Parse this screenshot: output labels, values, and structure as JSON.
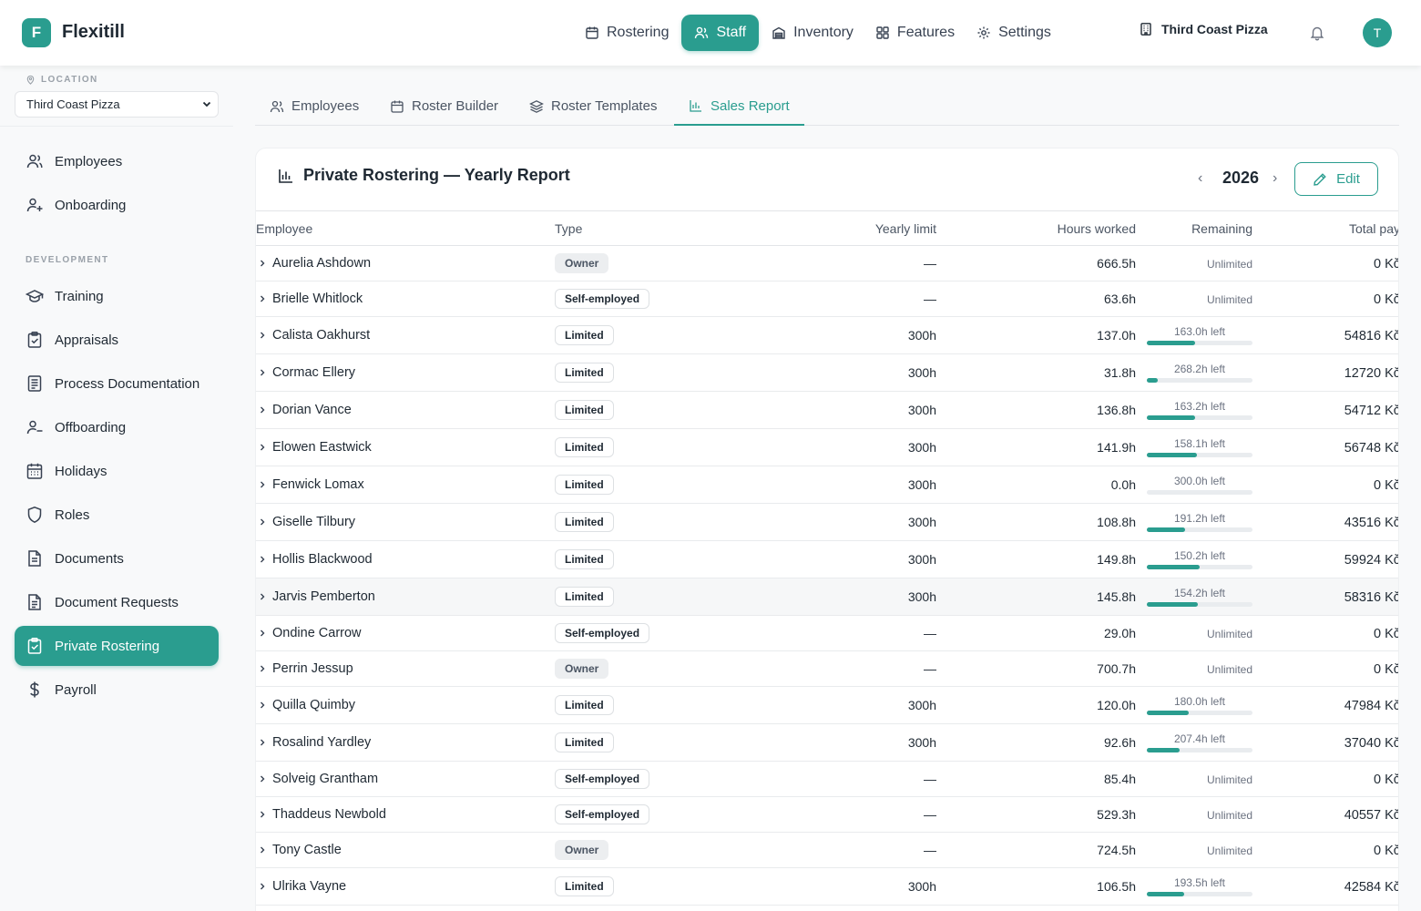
{
  "app": {
    "brand": "Flexitill",
    "logo_letter": "F",
    "avatar_letter": "T"
  },
  "nav": {
    "items": [
      {
        "label": "Rostering",
        "icon": "calendar-icon"
      },
      {
        "label": "Staff",
        "icon": "staff-icon",
        "active": true
      },
      {
        "label": "Inventory",
        "icon": "inventory-icon"
      },
      {
        "label": "Features",
        "icon": "grid-icon"
      },
      {
        "label": "Settings",
        "icon": "gear-icon"
      }
    ],
    "location": "Third Coast Pizza"
  },
  "sidebar": {
    "location_label": "LOCATION",
    "location_value": "Third Coast Pizza",
    "top_items": [
      {
        "label": "Employees",
        "icon": "users-icon"
      },
      {
        "label": "Onboarding",
        "icon": "user-plus-icon"
      }
    ],
    "section_label": "DEVELOPMENT",
    "dev_items": [
      {
        "label": "Training",
        "icon": "graduation-cap-icon"
      },
      {
        "label": "Appraisals",
        "icon": "clipboard-check-icon"
      },
      {
        "label": "Process Documentation",
        "icon": "book-icon"
      },
      {
        "label": "Offboarding",
        "icon": "user-minus-icon"
      },
      {
        "label": "Holidays",
        "icon": "calendar-icon"
      },
      {
        "label": "Roles",
        "icon": "shield-icon"
      },
      {
        "label": "Documents",
        "icon": "file-icon"
      },
      {
        "label": "Document Requests",
        "icon": "file-text-icon"
      },
      {
        "label": "Private Rostering",
        "icon": "clipboard-check-icon",
        "active": true
      },
      {
        "label": "Payroll",
        "icon": "dollar-icon"
      }
    ]
  },
  "tabs": [
    {
      "label": "Employees"
    },
    {
      "label": "Roster Builder"
    },
    {
      "label": "Roster Templates"
    },
    {
      "label": "Sales Report",
      "active": true
    }
  ],
  "report": {
    "title": "Private Rostering — Yearly Report",
    "year": "2026",
    "prev": "‹",
    "next": "›",
    "edit_label": "Edit",
    "columns": [
      "Employee",
      "Type",
      "Yearly limit",
      "Hours worked",
      "Remaining",
      "Total pay"
    ],
    "rows": [
      {
        "name": "Aurelia Ashdown",
        "type": "Owner",
        "limit": "—",
        "hours": "666.5h",
        "remaining": "Unlimited",
        "pay": "0 Kč"
      },
      {
        "name": "Brielle Whitlock",
        "type": "Self-employed",
        "limit": "—",
        "hours": "63.6h",
        "remaining": "Unlimited",
        "pay": "0 Kč"
      },
      {
        "name": "Calista Oakhurst",
        "type": "Limited",
        "limit": "300h",
        "hours": "137.0h",
        "remaining": "163.0h left",
        "used_fraction": 0.457,
        "pay": "54816 Kč"
      },
      {
        "name": "Cormac Ellery",
        "type": "Limited",
        "limit": "300h",
        "hours": "31.8h",
        "remaining": "268.2h left",
        "used_fraction": 0.106,
        "pay": "12720 Kč"
      },
      {
        "name": "Dorian Vance",
        "type": "Limited",
        "limit": "300h",
        "hours": "136.8h",
        "remaining": "163.2h left",
        "used_fraction": 0.456,
        "pay": "54712 Kč"
      },
      {
        "name": "Elowen Eastwick",
        "type": "Limited",
        "limit": "300h",
        "hours": "141.9h",
        "remaining": "158.1h left",
        "used_fraction": 0.473,
        "pay": "56748 Kč"
      },
      {
        "name": "Fenwick Lomax",
        "type": "Limited",
        "limit": "300h",
        "hours": "0.0h",
        "remaining": "300.0h left",
        "used_fraction": 0.0,
        "pay": "0 Kč"
      },
      {
        "name": "Giselle Tilbury",
        "type": "Limited",
        "limit": "300h",
        "hours": "108.8h",
        "remaining": "191.2h left",
        "used_fraction": 0.363,
        "pay": "43516 Kč"
      },
      {
        "name": "Hollis Blackwood",
        "type": "Limited",
        "limit": "300h",
        "hours": "149.8h",
        "remaining": "150.2h left",
        "used_fraction": 0.499,
        "pay": "59924 Kč"
      },
      {
        "name": "Jarvis Pemberton",
        "type": "Limited",
        "limit": "300h",
        "hours": "145.8h",
        "remaining": "154.2h left",
        "used_fraction": 0.486,
        "pay": "58316 Kč",
        "highlight": true
      },
      {
        "name": "Ondine Carrow",
        "type": "Self-employed",
        "limit": "—",
        "hours": "29.0h",
        "remaining": "Unlimited",
        "pay": "0 Kč"
      },
      {
        "name": "Perrin Jessup",
        "type": "Owner",
        "limit": "—",
        "hours": "700.7h",
        "remaining": "Unlimited",
        "pay": "0 Kč"
      },
      {
        "name": "Quilla Quimby",
        "type": "Limited",
        "limit": "300h",
        "hours": "120.0h",
        "remaining": "180.0h left",
        "used_fraction": 0.4,
        "pay": "47984 Kč"
      },
      {
        "name": "Rosalind Yardley",
        "type": "Limited",
        "limit": "300h",
        "hours": "92.6h",
        "remaining": "207.4h left",
        "used_fraction": 0.309,
        "pay": "37040 Kč"
      },
      {
        "name": "Solveig Grantham",
        "type": "Self-employed",
        "limit": "—",
        "hours": "85.4h",
        "remaining": "Unlimited",
        "pay": "0 Kč"
      },
      {
        "name": "Thaddeus Newbold",
        "type": "Self-employed",
        "limit": "—",
        "hours": "529.3h",
        "remaining": "Unlimited",
        "pay": "40557 Kč"
      },
      {
        "name": "Tony Castle",
        "type": "Owner",
        "limit": "—",
        "hours": "724.5h",
        "remaining": "Unlimited",
        "pay": "0 Kč"
      },
      {
        "name": "Ulrika Vayne",
        "type": "Limited",
        "limit": "300h",
        "hours": "106.5h",
        "remaining": "193.5h left",
        "used_fraction": 0.355,
        "pay": "42584 Kč"
      }
    ]
  },
  "colors": {
    "accent": "#2a9d8f"
  }
}
